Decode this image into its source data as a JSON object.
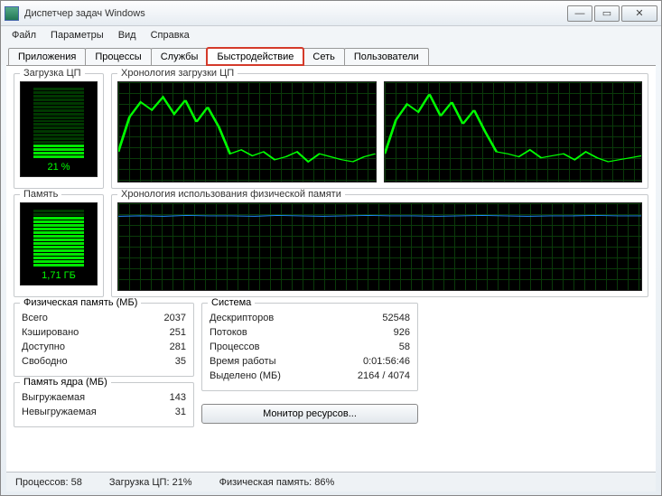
{
  "window": {
    "title": "Диспетчер задач Windows"
  },
  "menu": {
    "file": "Файл",
    "options": "Параметры",
    "view": "Вид",
    "help": "Справка"
  },
  "tabs": {
    "apps": "Приложения",
    "processes": "Процессы",
    "services": "Службы",
    "performance": "Быстродействие",
    "network": "Сеть",
    "users": "Пользователи"
  },
  "cpu": {
    "title": "Загрузка ЦП",
    "percent_label": "21 %",
    "history_title": "Хронология загрузки ЦП"
  },
  "mem": {
    "title": "Память",
    "value_label": "1,71 ГБ",
    "history_title": "Хронология использования физической памяти"
  },
  "phys_mem": {
    "title": "Физическая память (МБ)",
    "total_label": "Всего",
    "total_val": "2037",
    "cached_label": "Кэшировано",
    "cached_val": "251",
    "avail_label": "Доступно",
    "avail_val": "281",
    "free_label": "Свободно",
    "free_val": "35"
  },
  "kernel_mem": {
    "title": "Память ядра (МБ)",
    "paged_label": "Выгружаемая",
    "paged_val": "143",
    "nonpaged_label": "Невыгружаемая",
    "nonpaged_val": "31"
  },
  "system": {
    "title": "Система",
    "handles_label": "Дескрипторов",
    "handles_val": "52548",
    "threads_label": "Потоков",
    "threads_val": "926",
    "procs_label": "Процессов",
    "procs_val": "58",
    "uptime_label": "Время работы",
    "uptime_val": "0:01:56:46",
    "commit_label": "Выделено (МБ)",
    "commit_val": "2164 / 4074"
  },
  "res_button": "Монитор ресурсов...",
  "status": {
    "processes": "Процессов: 58",
    "cpu": "Загрузка ЦП: 21%",
    "mem": "Физическая память: 86%"
  },
  "chart_data": [
    {
      "type": "line",
      "title": "CPU Core 1",
      "ylabel": "%",
      "ylim": [
        0,
        100
      ],
      "x": [
        0,
        1,
        2,
        3,
        4,
        5,
        6,
        7,
        8,
        9,
        10,
        11,
        12,
        13,
        14,
        15,
        16,
        17,
        18,
        19,
        20,
        21,
        22,
        23
      ],
      "values": [
        30,
        65,
        80,
        72,
        85,
        68,
        82,
        60,
        75,
        55,
        28,
        32,
        26,
        30,
        22,
        25,
        30,
        20,
        28,
        25,
        22,
        20,
        25,
        28
      ]
    },
    {
      "type": "line",
      "title": "CPU Core 2",
      "ylabel": "%",
      "ylim": [
        0,
        100
      ],
      "x": [
        0,
        1,
        2,
        3,
        4,
        5,
        6,
        7,
        8,
        9,
        10,
        11,
        12,
        13,
        14,
        15,
        16,
        17,
        18,
        19,
        20,
        21,
        22,
        23
      ],
      "values": [
        28,
        62,
        78,
        70,
        88,
        66,
        80,
        58,
        72,
        50,
        30,
        28,
        25,
        32,
        24,
        26,
        28,
        22,
        30,
        24,
        20,
        22,
        24,
        26
      ]
    },
    {
      "type": "line",
      "title": "Физическая память",
      "ylabel": "ГБ",
      "ylim": [
        0,
        2
      ],
      "x": [
        0,
        1,
        2,
        3,
        4,
        5,
        6,
        7,
        8,
        9,
        10,
        11,
        12,
        13,
        14,
        15,
        16,
        17,
        18,
        19,
        20,
        21,
        22,
        23
      ],
      "values": [
        1.7,
        1.71,
        1.7,
        1.72,
        1.71,
        1.71,
        1.7,
        1.72,
        1.71,
        1.7,
        1.71,
        1.72,
        1.71,
        1.71,
        1.7,
        1.71,
        1.72,
        1.71,
        1.7,
        1.71,
        1.71,
        1.72,
        1.71,
        1.71
      ]
    }
  ]
}
